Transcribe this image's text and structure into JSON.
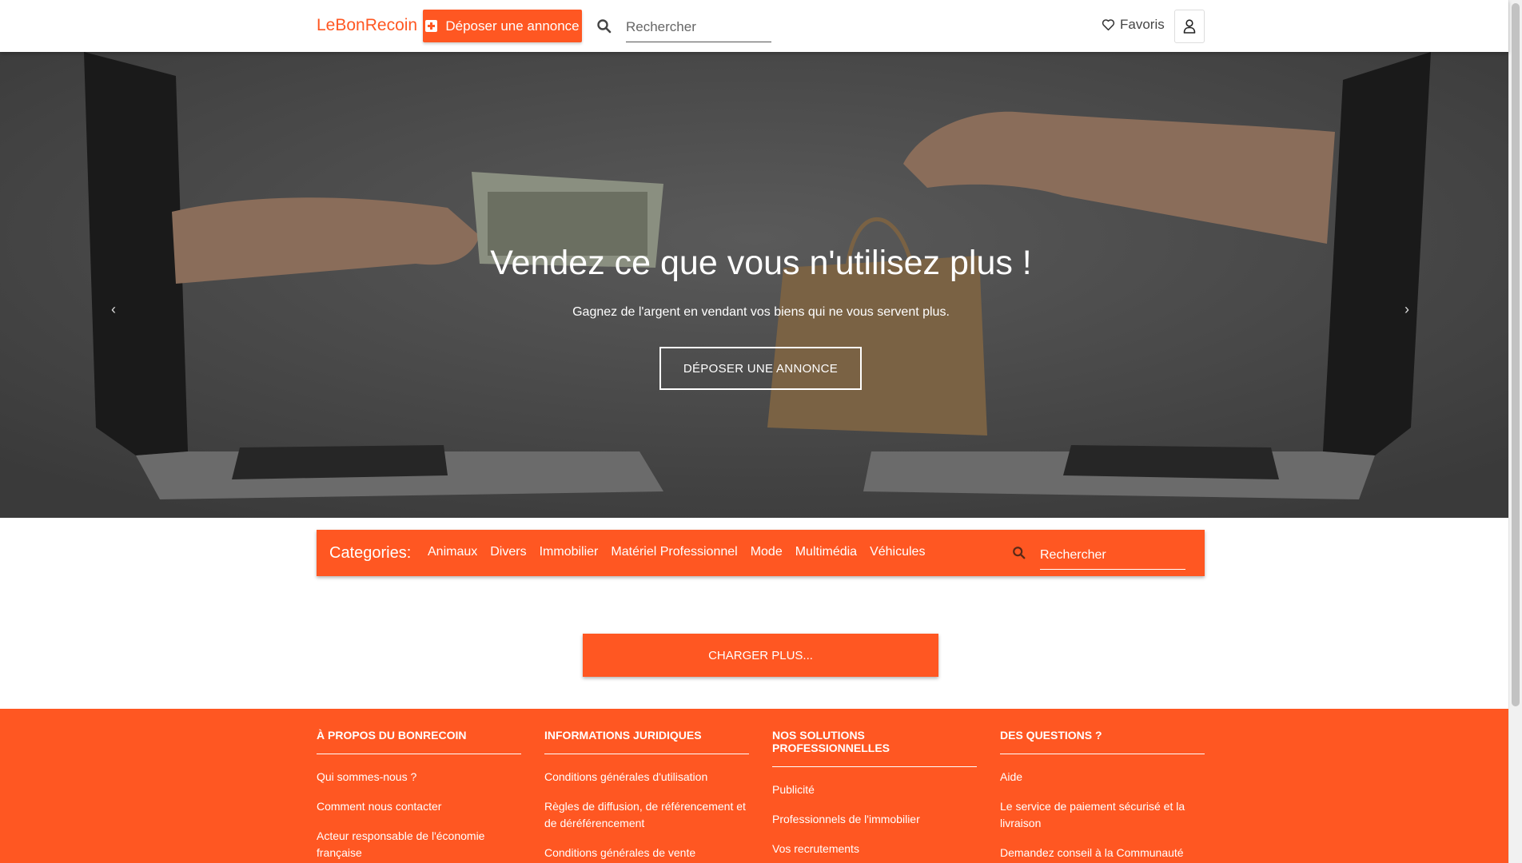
{
  "header": {
    "brand": "LeBonRecoin",
    "post_button": "Déposer une annonce",
    "search_placeholder": "Rechercher",
    "favorites": "Favoris"
  },
  "hero": {
    "title": "Vendez ce que vous n'utilisez plus !",
    "subtitle": "Gagnez de l'argent en vendant vos biens qui ne vous servent plus.",
    "button": "DÉPOSER UNE ANNONCE",
    "slides": 3,
    "active_slide": 2
  },
  "categories": {
    "title": "Categories:",
    "items": [
      "Animaux",
      "Divers",
      "Immobilier",
      "Matériel Professionnel",
      "Mode",
      "Multimédia",
      "Véhicules"
    ],
    "search_placeholder": "Rechercher"
  },
  "load_more": "CHARGER PLUS...",
  "footer": {
    "columns": [
      {
        "title": "À PROPOS DU BONRECOIN",
        "links": [
          "Qui sommes-nous ?",
          "Comment nous contacter",
          "Acteur responsable de l'économie française"
        ]
      },
      {
        "title": "INFORMATIONS JURIDIQUES",
        "links": [
          "Conditions générales d'utilisation",
          "Règles de diffusion, de référencement et de déréférencement",
          "Conditions générales de vente"
        ]
      },
      {
        "title": "NOS SOLUTIONS PROFESSIONNELLES",
        "links": [
          "Publicité",
          "Professionnels de l'immobilier",
          "Vos recrutements"
        ]
      },
      {
        "title": "DES QUESTIONS ?",
        "links": [
          "Aide",
          "Le service de paiement sécurisé et la livraison",
          "Demandez conseil à la Communauté"
        ]
      }
    ]
  },
  "colors": {
    "accent": "#ff5722",
    "hero_overlay": "#4a4a4a"
  }
}
